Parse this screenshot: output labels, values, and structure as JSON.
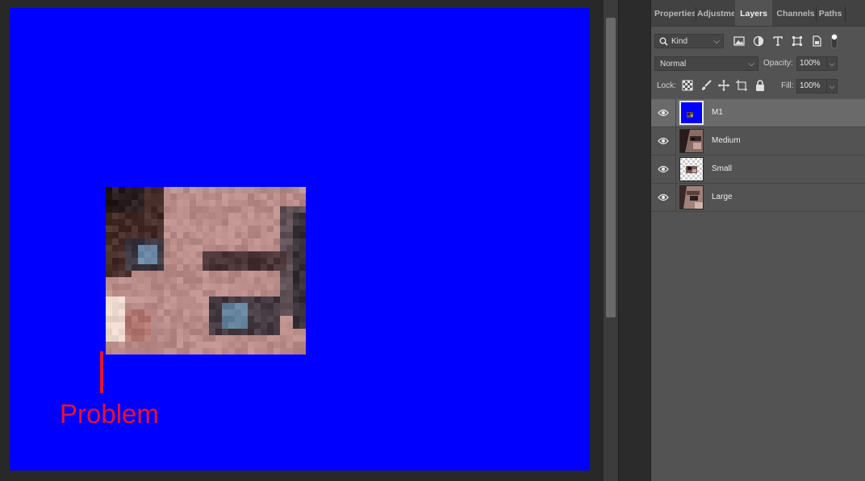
{
  "canvas": {
    "background_color": "#0000ff",
    "annotation": {
      "text": "Problem",
      "color": "#e8132b"
    }
  },
  "panel": {
    "tabs": [
      {
        "label": "Properties",
        "active": false
      },
      {
        "label": "Adjustments",
        "active": false
      },
      {
        "label": "Layers",
        "active": true
      },
      {
        "label": "Channels",
        "active": false
      },
      {
        "label": "Paths",
        "active": false
      }
    ],
    "filter": {
      "label": "Kind",
      "icons": [
        "image-filter-icon",
        "adjustment-filter-icon",
        "type-filter-icon",
        "shape-filter-icon",
        "smart-object-filter-icon",
        "filter-toggle-icon"
      ]
    },
    "blend_mode": "Normal",
    "opacity_label": "Opacity:",
    "opacity_value": "100%",
    "lock_label": "Lock:",
    "lock_icons": [
      "lock-transparent-pixels-icon",
      "lock-image-pixels-icon",
      "lock-position-icon",
      "lock-artboard-icon",
      "lock-all-icon"
    ],
    "fill_label": "Fill:",
    "fill_value": "100%",
    "layers": [
      {
        "name": "M1",
        "visible": true,
        "selected": true,
        "thumb": "blue"
      },
      {
        "name": "Medium",
        "visible": true,
        "selected": false,
        "thumb": "face"
      },
      {
        "name": "Small",
        "visible": true,
        "selected": false,
        "thumb": "transparent"
      },
      {
        "name": "Large",
        "visible": true,
        "selected": false,
        "thumb": "face"
      }
    ]
  }
}
